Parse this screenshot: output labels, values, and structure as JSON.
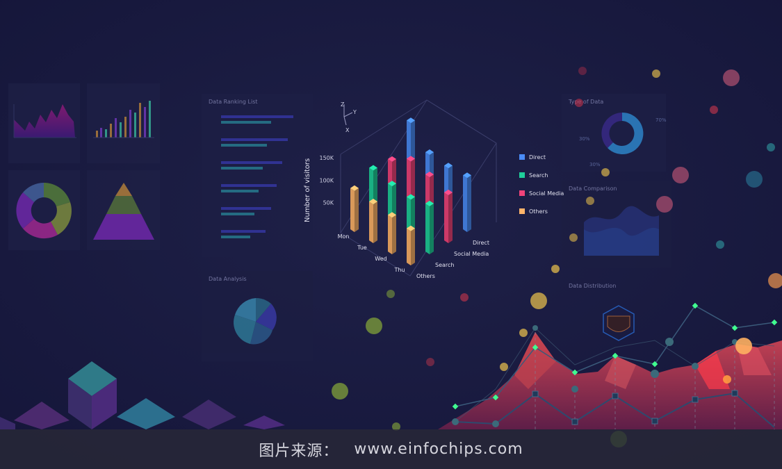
{
  "chart_data": {
    "type": "bar",
    "title": "",
    "ylabel": "Number of visitors",
    "yticks": [
      "50K",
      "100K",
      "150K"
    ],
    "categories": [
      "Mon",
      "Tue",
      "Wed",
      "Thu"
    ],
    "series_axis": [
      "Others",
      "Search",
      "Social Media",
      "Direct"
    ],
    "axis_letters": {
      "z": "Z",
      "y": "Y",
      "x": "X"
    },
    "ylim": [
      0,
      170000
    ],
    "series": [
      {
        "name": "Direct",
        "color": "#4a8cf7",
        "values": [
          165000,
          120000,
          115000,
          118000
        ]
      },
      {
        "name": "Search",
        "color": "#1fcf9a",
        "values": [
          110000,
          100000,
          95000,
          105000
        ]
      },
      {
        "name": "Social Media",
        "color": "#f0437a",
        "values": [
          105000,
          130000,
          120000,
          105000
        ]
      },
      {
        "name": "Others",
        "color": "#ffb46a",
        "values": [
          90000,
          85000,
          80000,
          75000
        ]
      }
    ]
  },
  "panels": {
    "ranking_title": "Data Ranking List",
    "type_title": "Type of Data",
    "type_pct_a": "70%",
    "type_pct_b": "30%",
    "type_pct_c": "30%",
    "comparison_title": "Data Comparison",
    "analysis_title": "Data Analysis",
    "distribution_title": "Data Distribution"
  },
  "caption": {
    "prefix": "图片来源：",
    "source": "www.einfochips.com"
  }
}
